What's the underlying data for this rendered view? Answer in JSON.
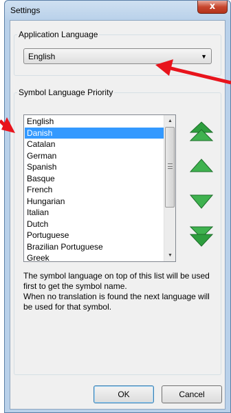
{
  "window": {
    "title": "Settings",
    "close_label": "x"
  },
  "app_language": {
    "group_label": "Application Language",
    "selected": "English"
  },
  "symbol_priority": {
    "group_label": "Symbol Language Priority",
    "items": [
      "English",
      "Danish",
      "Catalan",
      "German",
      "Spanish",
      "Basque",
      "French",
      "Hungarian",
      "Italian",
      "Dutch",
      "Portuguese",
      "Brazilian Portuguese",
      "Greek"
    ],
    "selected_index": 1,
    "description": "The symbol language on top of this list will be used first to get the symbol name.\nWhen no translation is found the next language will be used for that symbol."
  },
  "buttons": {
    "move_top_icon": "double-up-arrow-icon",
    "move_up_icon": "up-arrow-icon",
    "move_down_icon": "down-arrow-icon",
    "move_bottom_icon": "double-down-arrow-icon",
    "ok_label": "OK",
    "cancel_label": "Cancel"
  },
  "colors": {
    "selection": "#3399ff",
    "move_arrows": "#2e9e3e",
    "annotation_arrows": "#e8141c",
    "close_button": "#c7462e"
  }
}
